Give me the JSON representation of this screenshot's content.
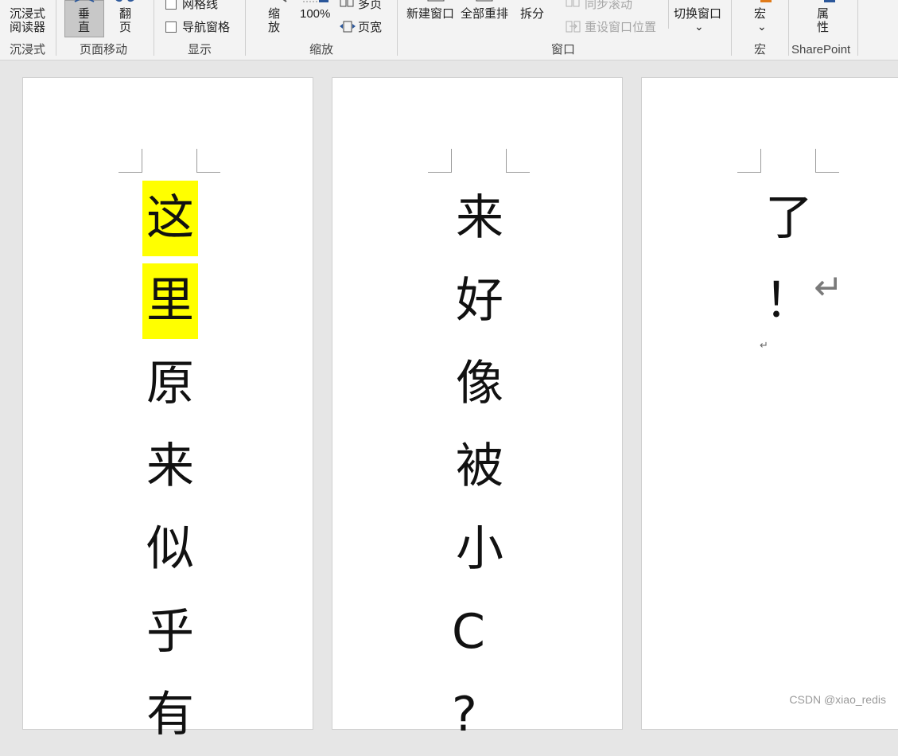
{
  "ribbon": {
    "immersive": {
      "reader_line1": "沉浸式",
      "reader_line2": "阅读器",
      "group": "沉浸式"
    },
    "page_movement": {
      "vertical_line1": "垂",
      "vertical_line2": "直",
      "flip_line1": "翻",
      "flip_line2": "页",
      "group": "页面移动"
    },
    "show": {
      "gridlines": "网格线",
      "nav_pane": "导航窗格",
      "group": "显示"
    },
    "zoom": {
      "zoom_line1": "缩",
      "zoom_line2": "放",
      "percent": "100%",
      "multi_page": "多页",
      "page_width": "页宽",
      "group": "缩放"
    },
    "window": {
      "new_window": "新建窗口",
      "arrange_all": "全部重排",
      "split": "拆分",
      "sync_scroll": "同步滚动",
      "reset_position": "重设窗口位置",
      "switch_windows": "切换窗口",
      "chevron": "⌄",
      "group": "窗口"
    },
    "macros": {
      "label": "宏",
      "chevron": "⌄",
      "group": "宏"
    },
    "sharepoint": {
      "prop_line1": "属",
      "prop_line2": "性",
      "group": "SharePoint"
    }
  },
  "pages": [
    {
      "chars": [
        "这",
        "里",
        "原",
        "来",
        "似",
        "乎",
        "有"
      ],
      "highlighted": [
        0,
        1
      ]
    },
    {
      "chars": [
        "来",
        "好",
        "像",
        "被",
        "小",
        "C",
        "?"
      ]
    },
    {
      "chars": [
        "了",
        "！"
      ],
      "return_mark": "↵",
      "paragraph_mark": "↵"
    }
  ],
  "watermark": "CSDN @xiao_redis",
  "colors": {
    "highlight": "#ffff00",
    "accent": "#2b579a"
  }
}
